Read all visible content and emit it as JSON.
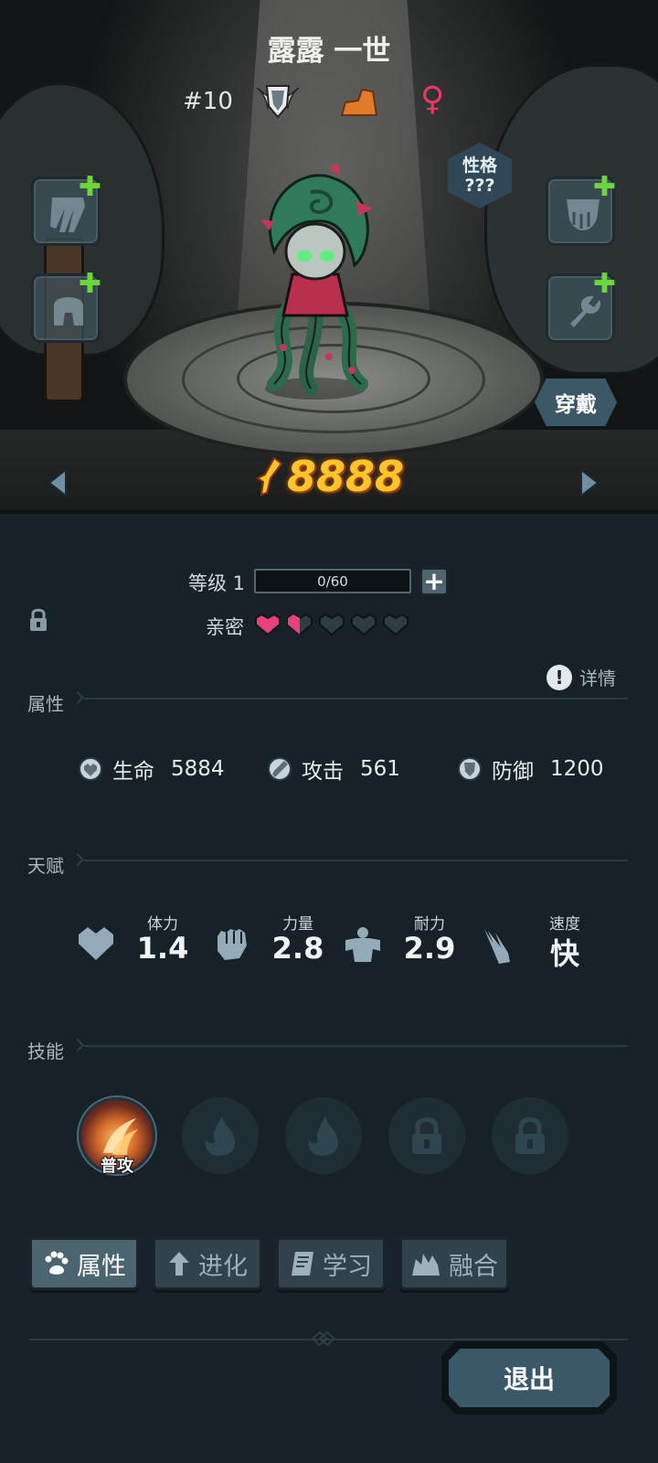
{
  "character": {
    "name": "露露 一世",
    "number": "#10",
    "badge_icon": "winged-shield-icon",
    "element_icon": "earth-element-icon",
    "gender_icon": "female-icon",
    "gender_symbol": "♀",
    "gender_color": "#e83a66"
  },
  "personality": {
    "label": "性格",
    "value": "???"
  },
  "equipment_slots": [
    {
      "icon": "claw-weapon-icon",
      "side": "left"
    },
    {
      "icon": "helmet-icon",
      "side": "left"
    },
    {
      "icon": "gauntlet-icon",
      "side": "right"
    },
    {
      "icon": "accessory-icon",
      "side": "right"
    }
  ],
  "equip_button": "穿戴",
  "power": "8888",
  "level": {
    "label": "等级 1",
    "xp_text": "0/60",
    "xp_progress": 0
  },
  "intimacy": {
    "label": "亲密",
    "hearts_total": 5,
    "hearts_filled": 1.5
  },
  "attributes_section": {
    "title": "属性",
    "detail_label": "详情"
  },
  "stats": [
    {
      "icon": "heart-shield-icon",
      "name": "生命",
      "value": "5884"
    },
    {
      "icon": "sword-icon",
      "name": "攻击",
      "value": "561"
    },
    {
      "icon": "shield-icon",
      "name": "防御",
      "value": "1200"
    }
  ],
  "talent_section": {
    "title": "天赋"
  },
  "talents": [
    {
      "icon": "heart-icon",
      "name": "体力",
      "value": "1.4"
    },
    {
      "icon": "fist-icon",
      "name": "力量",
      "value": "2.8"
    },
    {
      "icon": "muscle-icon",
      "name": "耐力",
      "value": "2.9"
    },
    {
      "icon": "wing-icon",
      "name": "速度",
      "value": "快"
    }
  ],
  "skill_section": {
    "title": "技能"
  },
  "skills": [
    {
      "label": "普攻",
      "state": "unlocked"
    },
    {
      "state": "empty"
    },
    {
      "state": "empty"
    },
    {
      "state": "locked"
    },
    {
      "state": "locked"
    }
  ],
  "tabs": [
    {
      "label": "属性",
      "icon": "paw-icon",
      "active": true
    },
    {
      "label": "进化",
      "icon": "up-arrow-icon",
      "active": false
    },
    {
      "label": "学习",
      "icon": "book-icon",
      "active": false
    },
    {
      "label": "融合",
      "icon": "fusion-icon",
      "active": false
    }
  ],
  "exit_button": "退出",
  "colors": {
    "power": "#ffc52a",
    "heart_filled": "#e8417a",
    "plus_green": "#6cd63a",
    "panel_bg": "#162128"
  }
}
